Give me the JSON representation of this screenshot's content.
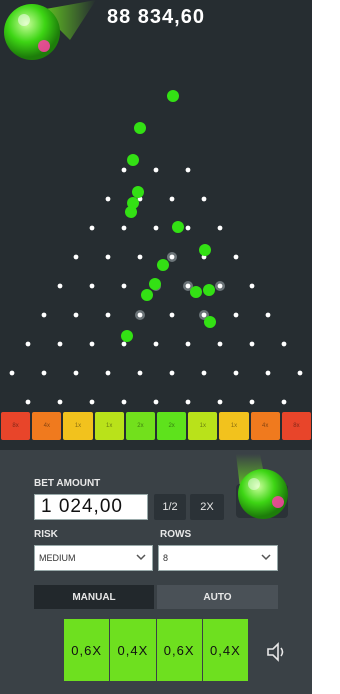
{
  "balance": "88 834,60",
  "bet": {
    "label": "BET AMOUNT",
    "value": "1 024,00",
    "half_label": "1/2",
    "double_label": "2X"
  },
  "risk": {
    "label": "RISK",
    "value": "MEDIUM"
  },
  "rows": {
    "label": "ROWS",
    "value": "8"
  },
  "tabs": {
    "manual": "MANUAL",
    "auto": "AUTO"
  },
  "history": [
    "0,6X",
    "0,4X",
    "0,6X",
    "0,4X"
  ],
  "slots": [
    {
      "label": "8x",
      "color": "#e8452a"
    },
    {
      "label": "4x",
      "color": "#f07a1e"
    },
    {
      "label": "1x",
      "color": "#f2c21d"
    },
    {
      "label": "1x",
      "color": "#b9e21a"
    },
    {
      "label": "2x",
      "color": "#72e01c"
    },
    {
      "label": "2x",
      "color": "#5ee21c"
    },
    {
      "label": "1x",
      "color": "#b9e21a"
    },
    {
      "label": "1x",
      "color": "#f2c21d"
    },
    {
      "label": "4x",
      "color": "#f07a1e"
    },
    {
      "label": "8x",
      "color": "#e8452a"
    }
  ],
  "colors": {
    "ball": "#33e014",
    "accent": "#6ee01f",
    "panel": "#3a4146",
    "board": "#262d31"
  }
}
